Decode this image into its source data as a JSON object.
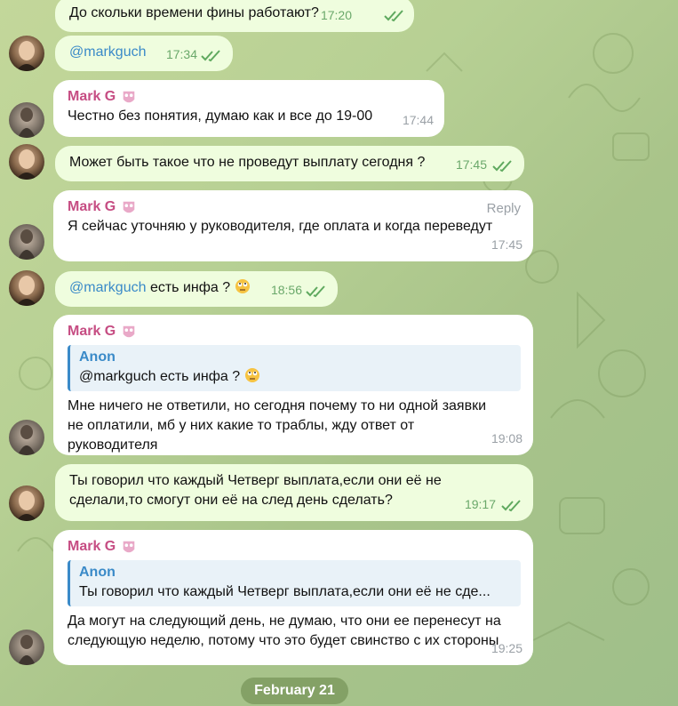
{
  "chat": {
    "messages": [
      {
        "id": "m1",
        "text": "До скольки времени фины работают?",
        "time": "17:20"
      },
      {
        "id": "m2",
        "mention": "@markguch",
        "time": "17:34"
      },
      {
        "id": "m3",
        "sender": "Mark G",
        "text": "Честно без понятия, думаю как и все до 19-00",
        "time": "17:44"
      },
      {
        "id": "m4",
        "text": "Может быть такое что не проведут выплату сегодня ?",
        "time": "17:45"
      },
      {
        "id": "m5",
        "sender": "Mark G",
        "reply_label": "Reply",
        "text": "Я сейчас уточняю у руководителя, где оплата и когда переведут",
        "time": "17:45"
      },
      {
        "id": "m6",
        "mention": "@markguch",
        "text": " есть инфа ?",
        "time": "18:56"
      },
      {
        "id": "m7",
        "sender": "Mark G",
        "quote_name": "Anon",
        "quote_text": "@markguch есть инфа ?",
        "text_lines": [
          "Мне ничего не ответили, но сегодня почему то ни одной заявки",
          "не оплатили, мб у них какие то траблы, жду ответ от",
          "руководителя"
        ],
        "time": "19:08"
      },
      {
        "id": "m8",
        "text_lines": [
          "Ты говорил что каждый Четверг выплата,если они её не",
          "сделали,то смогут они её на след день сделать?"
        ],
        "time": "19:17"
      },
      {
        "id": "m9",
        "sender": "Mark G",
        "quote_name": "Anon",
        "quote_text": "Ты говорил что каждый Четверг выплата,если они её не сде...",
        "text_lines": [
          "Да могут на следующий день, не думаю, что они ее перенесут на",
          "следующую неделю, потому что это будет свинство с их стороны"
        ],
        "time": "19:25"
      }
    ],
    "date_separator": "February 21"
  },
  "colors": {
    "outgoing_bubble": "#effdde",
    "incoming_bubble": "#ffffff",
    "sender_name": "#c64d83",
    "mention": "#3a8ac8",
    "time_outgoing": "#6aa86a",
    "time_incoming": "#9aa0a6"
  },
  "icons": {
    "read_ticks": "double-check-icon",
    "sender_badge": "mask-icon",
    "emoji": "rolling-eyes-emoji"
  }
}
